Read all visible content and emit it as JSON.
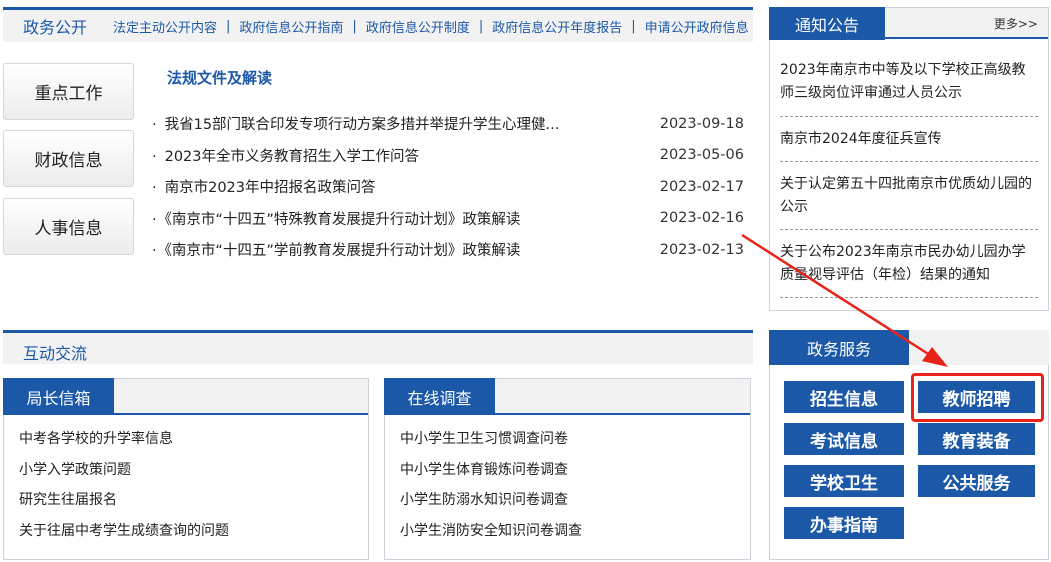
{
  "gov_open": {
    "title": "政务公开",
    "links": [
      "法定主动公开内容",
      "政府信息公开指南",
      "政府信息公开制度",
      "政府信息公开年度报告",
      "申请公开政府信息"
    ],
    "side_buttons": [
      "重点工作",
      "财政信息",
      "人事信息"
    ]
  },
  "laws": {
    "title": "法规文件及解读",
    "items": [
      {
        "title": "我省15部门联合印发专项行动方案多措并举提升学生心理健...",
        "date": "2023-09-18"
      },
      {
        "title": "2023年全市义务教育招生入学工作问答",
        "date": "2023-05-06"
      },
      {
        "title": "南京市2023年中招报名政策问答",
        "date": "2023-02-17"
      },
      {
        "title": "《南京市“十四五”特殊教育发展提升行动计划》政策解读",
        "date": "2023-02-16"
      },
      {
        "title": "《南京市“十四五”学前教育发展提升行动计划》政策解读",
        "date": "2023-02-13"
      }
    ]
  },
  "notices": {
    "title": "通知公告",
    "more": "更多>>",
    "items": [
      "2023年南京市中等及以下学校正高级教师三级岗位评审通过人员公示",
      "南京市2024年度征兵宣传",
      "关于认定第五十四批南京市优质幼儿园的公示",
      "关于公布2023年南京市民办幼儿园办学质量视导评估（年检）结果的通知"
    ]
  },
  "interaction": {
    "title": "互动交流",
    "mailbox": {
      "title": "局长信箱",
      "items": [
        "中考各学校的升学率信息",
        "小学入学政策问题",
        "研究生往届报名",
        "关于往届中考学生成绩查询的问题"
      ]
    },
    "survey": {
      "title": "在线调查",
      "items": [
        "中小学生卫生习惯调查问卷",
        "中小学生体育锻炼问卷调查",
        "小学生防溺水知识问卷调查",
        "小学生消防安全知识问卷调查"
      ]
    }
  },
  "services": {
    "title": "政务服务",
    "buttons": [
      "招生信息",
      "教师招聘",
      "考试信息",
      "教育装备",
      "学校卫生",
      "公共服务",
      "办事指南"
    ],
    "highlighted": "教师招聘"
  },
  "colors": {
    "primary": "#1c58a8",
    "highlight": "#e8241a",
    "bar_bg": "#f2f2f2"
  }
}
